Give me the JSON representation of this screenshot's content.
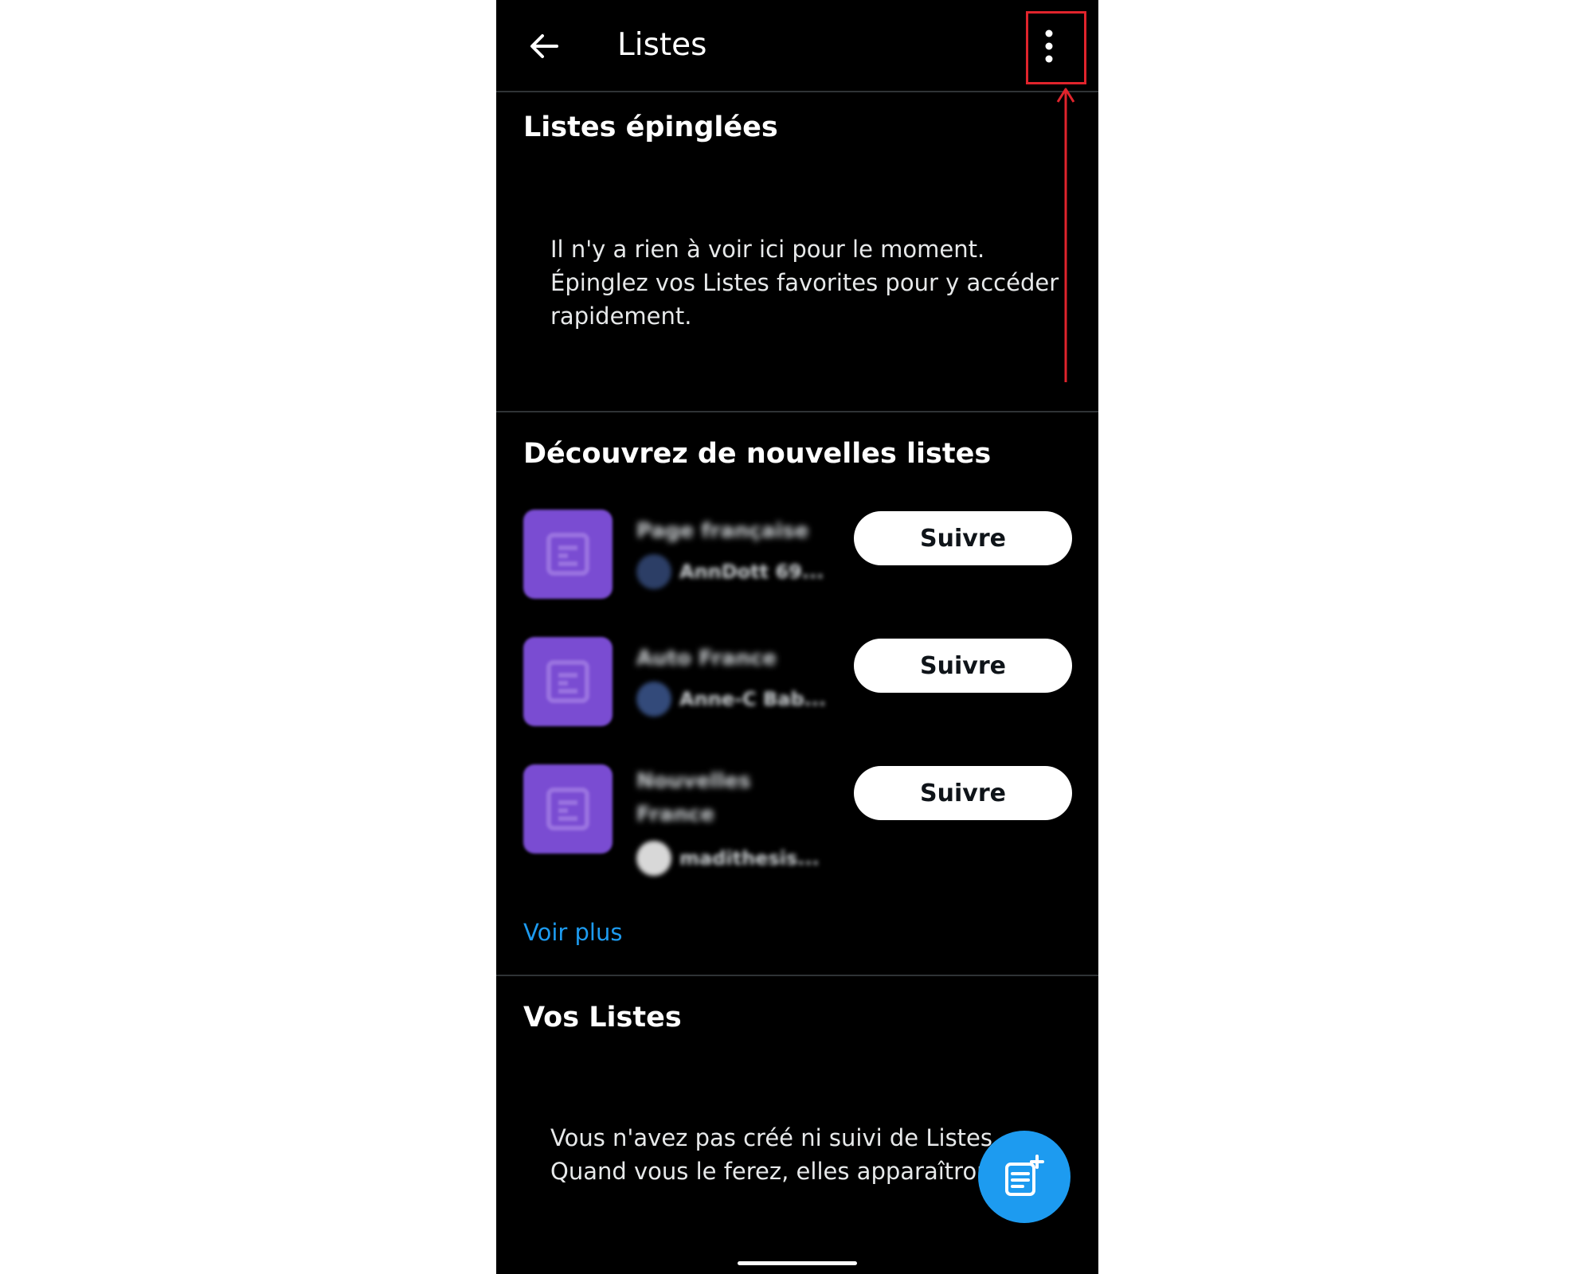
{
  "header": {
    "title": "Listes"
  },
  "pinned": {
    "title": "Listes épinglées",
    "empty_line1": "Il n'y a rien à voir ici pour le moment.",
    "empty_line2": "Épinglez vos Listes favorites pour y accéder",
    "empty_line3": "rapidement."
  },
  "discover": {
    "title": "Découvrez de nouvelles listes",
    "items": [
      {
        "name": "Page française",
        "owner": "AnnDott 69...",
        "follow_label": "Suivre"
      },
      {
        "name": "Auto France",
        "owner": "Anne-C Bab...",
        "follow_label": "Suivre"
      },
      {
        "name": "Nouvelles",
        "name2": "France",
        "owner": "madithesis...",
        "follow_label": "Suivre"
      }
    ],
    "see_more": "Voir plus"
  },
  "your_lists": {
    "title": "Vos Listes",
    "empty_line1": "Vous n'avez pas créé ni suivi de Listes.",
    "empty_line2": "Quand vous le ferez, elles apparaîtront"
  },
  "colors": {
    "background": "#000000",
    "accent": "#1d9bf0",
    "highlight": "#e0242c",
    "list_avatar": "#7a4cd2"
  },
  "icons": {
    "back": "arrow-left-icon",
    "more": "more-vertical-icon",
    "fab": "new-list-icon"
  }
}
